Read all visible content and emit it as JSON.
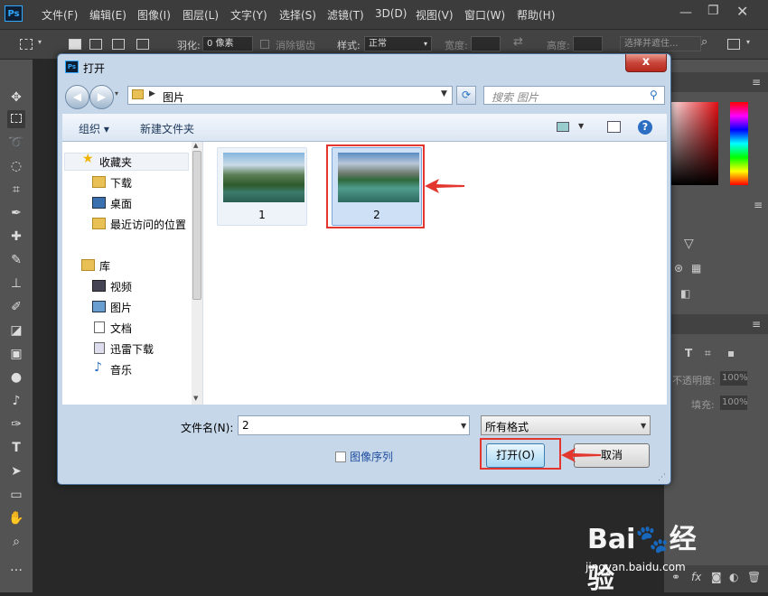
{
  "app": {
    "logo": "Ps",
    "menu": [
      "文件(F)",
      "编辑(E)",
      "图像(I)",
      "图层(L)",
      "文字(Y)",
      "选择(S)",
      "滤镜(T)",
      "3D(D)",
      "视图(V)",
      "窗口(W)",
      "帮助(H)"
    ],
    "window_controls": {
      "minimize": "—",
      "restore": "❐",
      "close": "✕"
    }
  },
  "options_bar": {
    "feather_label": "羽化:",
    "feather_value": "0 像素",
    "antialias_label": "消除锯齿",
    "style_label": "样式:",
    "style_value": "正常",
    "width_label": "宽度:",
    "height_label": "高度:",
    "select_mask_label": "选择并遮住..."
  },
  "right_panel": {
    "opacity_label": "不透明度:",
    "opacity_value": "100%",
    "fill_label": "填充:",
    "fill_value": "100%"
  },
  "dialog": {
    "title": "打开",
    "close_label": "x",
    "address": "图片",
    "search_placeholder": "搜索 图片",
    "organize_label": "组织 ▾",
    "new_folder_label": "新建文件夹",
    "help_label": "?",
    "nav": {
      "favorites": "收藏夹",
      "fav_items": [
        "下载",
        "桌面",
        "最近访问的位置"
      ],
      "library": "库",
      "lib_items": [
        "视频",
        "图片",
        "文档",
        "迅雷下载",
        "音乐"
      ]
    },
    "files": [
      {
        "name": "1"
      },
      {
        "name": "2",
        "selected": true
      }
    ],
    "filename_label": "文件名(N):",
    "filename_value": "2",
    "filetype_value": "所有格式",
    "image_sequence_label": "图像序列",
    "open_label": "打开(O)",
    "cancel_label": "取消"
  },
  "watermark": {
    "text": "Bai🐾经验",
    "sub": "jingyan.baidu.com"
  },
  "colors": {
    "ps_blue": "#31a8ff",
    "highlight_red": "#e2362f",
    "dialog_frame": "#c6d7ea"
  }
}
